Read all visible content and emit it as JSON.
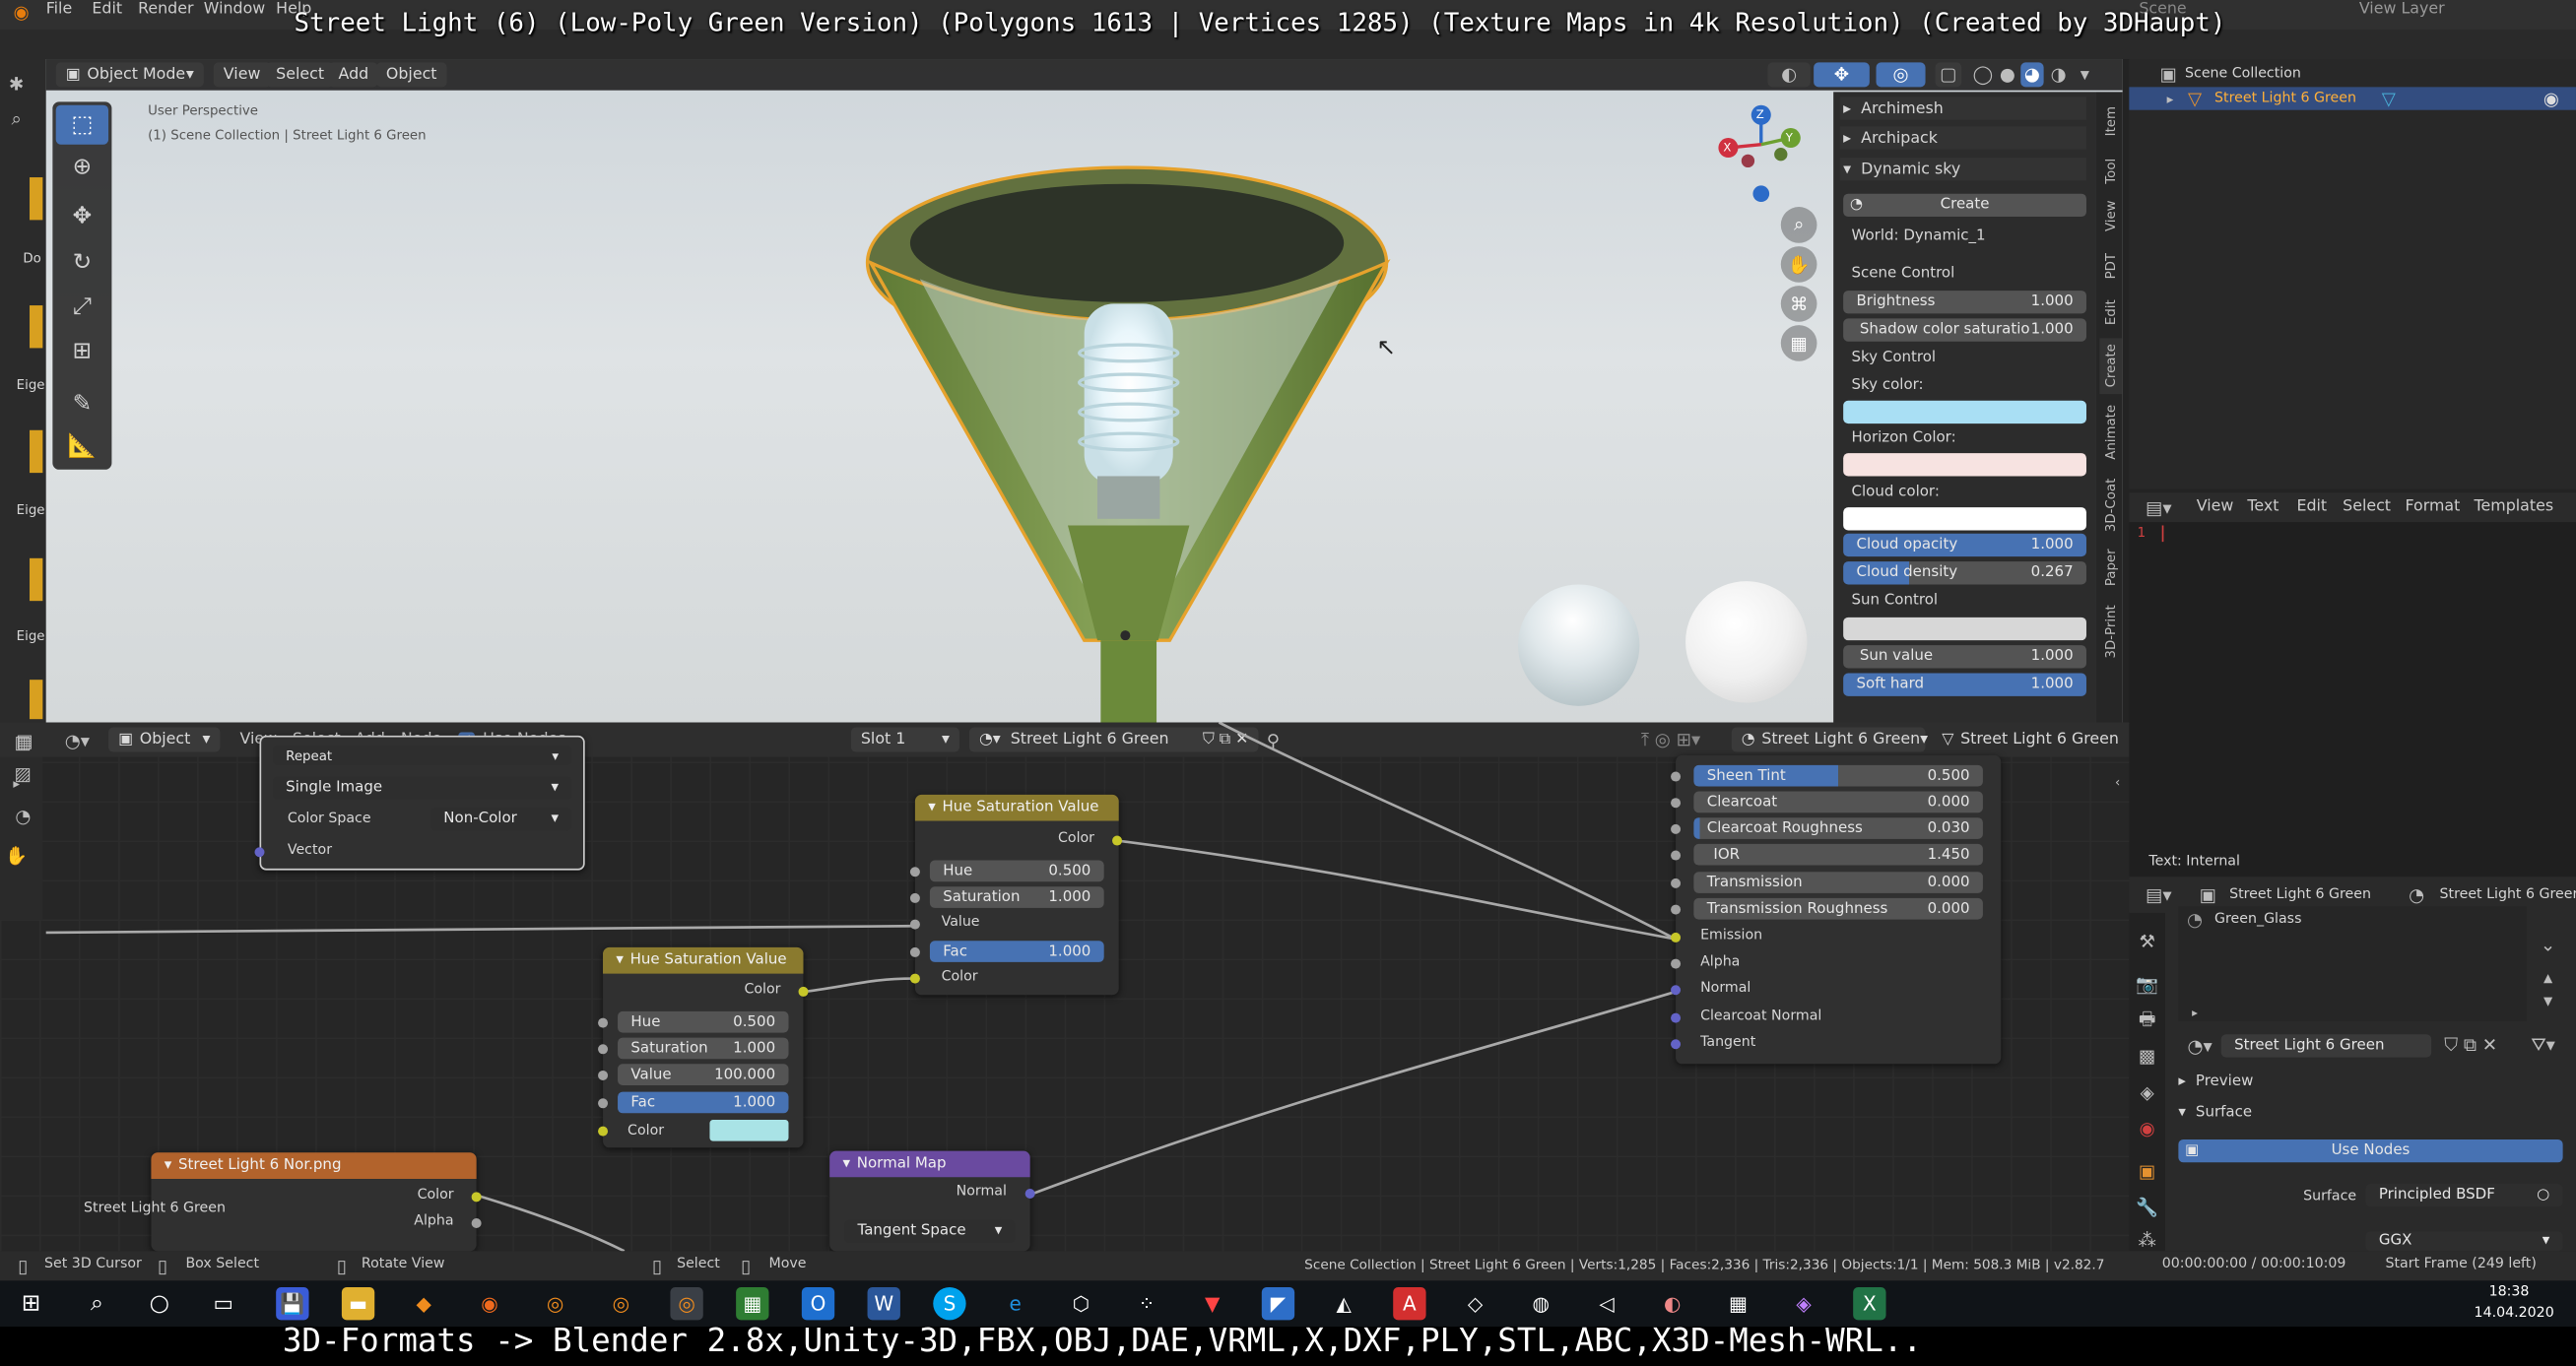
{
  "top_caption": "Street Light (6) (Low-Poly Green Version) (Polygons 1613 | Vertices 1285) (Texture Maps in 4k Resolution) (Created by 3DHaupt)",
  "bottom_caption": "3D-Formats -> Blender 2.8x,Unity-3D,FBX,OBJ,DAE,VRML,X,DXF,PLY,STL,ABC,X3D-Mesh-WRL..",
  "topbar": {
    "menus": [
      "File",
      "Edit",
      "Render",
      "Window",
      "Help"
    ],
    "right_label": "View Layer",
    "scene": "Scene"
  },
  "viewport": {
    "mode": "Object Mode",
    "menus": [
      "View",
      "Select",
      "Add",
      "Object"
    ],
    "perspective": "User Perspective",
    "collection_path": "(1) Scene Collection | Street Light 6 Green",
    "gizmo": {
      "x": "X",
      "y": "Y",
      "z": "Z"
    }
  },
  "npanel": {
    "sections": [
      "Archimesh",
      "Archipack",
      "Dynamic sky"
    ],
    "create_button": "Create",
    "world": "World: Dynamic_1",
    "scene_control": "Scene Control",
    "brightness": {
      "label": "Brightness",
      "value": "1.000"
    },
    "shadow": {
      "label": "Shadow color saturatio",
      "value": "1.000"
    },
    "sky_control": "Sky Control",
    "sky_color": "Sky color:",
    "horizon_color": "Horizon Color:",
    "cloud_color": "Cloud color:",
    "cloud_opacity": {
      "label": "Cloud opacity",
      "value": "1.000"
    },
    "cloud_density": {
      "label": "Cloud density",
      "value": "0.267"
    },
    "sun_control": "Sun Control",
    "sun_value": {
      "label": "Sun value",
      "value": "1.000"
    },
    "soft_hard": {
      "label": "Soft hard",
      "value": "1.000"
    },
    "tabs": [
      "Item",
      "Tool",
      "View",
      "PDT",
      "Edit",
      "Create",
      "Animate",
      "3D-Coat",
      "Paper",
      "3D-Print"
    ],
    "colors": {
      "sky": "#a9dff4",
      "horizon": "#f7e3e1",
      "cloud": "#ffffff"
    }
  },
  "outliner": {
    "root": "Scene Collection",
    "item": "Street Light 6 Green"
  },
  "text_editor": {
    "menus": [
      "View",
      "Text",
      "Edit",
      "Select",
      "Format",
      "Templates"
    ],
    "line": "1",
    "status": "Text: Internal"
  },
  "node_header": {
    "editor": "Object",
    "menus": [
      "View",
      "Select",
      "Add",
      "Node"
    ],
    "use_nodes": "Use Nodes",
    "slot": "Slot 1",
    "material": "Street Light 6 Green",
    "object": "Street Light 6 Green",
    "object2": "Street Light 6 Green"
  },
  "nodes": {
    "image_tex": {
      "repeat": "Repeat",
      "single": "Single Image",
      "color_space_label": "Color Space",
      "color_space": "Non-Color",
      "vector": "Vector"
    },
    "hsv1": {
      "title": "Hue Saturation Value",
      "color_out": "Color",
      "hue": "Hue",
      "hue_v": "0.500",
      "sat": "Saturation",
      "sat_v": "1.000",
      "value": "Value",
      "fac": "Fac",
      "fac_v": "1.000",
      "color_in": "Color"
    },
    "hsv2": {
      "title": "Hue Saturation Value",
      "color_out": "Color",
      "hue": "Hue",
      "hue_v": "0.500",
      "sat": "Saturation",
      "sat_v": "1.000",
      "value": "Value",
      "value_v": "100.000",
      "fac": "Fac",
      "fac_v": "1.000",
      "color_in": "Color",
      "swatch": "#a9e3e6"
    },
    "bsdf": {
      "sheen_tint": "Sheen Tint",
      "sheen_tint_v": "0.500",
      "clearcoat": "Clearcoat",
      "clearcoat_v": "0.000",
      "cc_rough": "Clearcoat Roughness",
      "cc_rough_v": "0.030",
      "ior": "IOR",
      "ior_v": "1.450",
      "transmission": "Transmission",
      "transmission_v": "0.000",
      "trans_rough": "Transmission Roughness",
      "trans_rough_v": "0.000",
      "emission": "Emission",
      "alpha": "Alpha",
      "normal": "Normal",
      "cc_normal": "Clearcoat Normal",
      "tangent": "Tangent"
    },
    "nor_tex": {
      "title": "Street Light 6 Nor.png",
      "color": "Color",
      "alpha": "Alpha"
    },
    "normal_map": {
      "title": "Normal Map",
      "normal": "Normal",
      "space": "Tangent Space"
    },
    "frame_label": "Street Light 6 Green"
  },
  "properties": {
    "object": "Street Light 6 Green",
    "material_ptr": "Street Light 6 Greer",
    "slot_item": "Green_Glass",
    "material": "Street Light 6 Green",
    "preview": "Preview",
    "surface": "Surface",
    "use_nodes": "Use Nodes",
    "surface_label": "Surface",
    "surface_value": "Principled BSDF",
    "distribution": "GGX"
  },
  "statusbar": {
    "set_cursor": "Set 3D Cursor",
    "box_select": "Box Select",
    "rotate": "Rotate View",
    "select": "Select",
    "move": "Move",
    "info": "Scene Collection | Street Light 6 Green | Verts:1,285 | Faces:2,336 | Tris:2,336 | Objects:1/1 | Mem: 508.3 MiB | v2.82.7",
    "time": "00:00:00:00 / 00:00:10:09",
    "start_frame": "Start Frame (249 left)"
  },
  "taskbar": {
    "time": "18:38",
    "date": "14.04.2020"
  },
  "left_strip": [
    "Do",
    "Eige",
    "Eige",
    "Eige"
  ]
}
